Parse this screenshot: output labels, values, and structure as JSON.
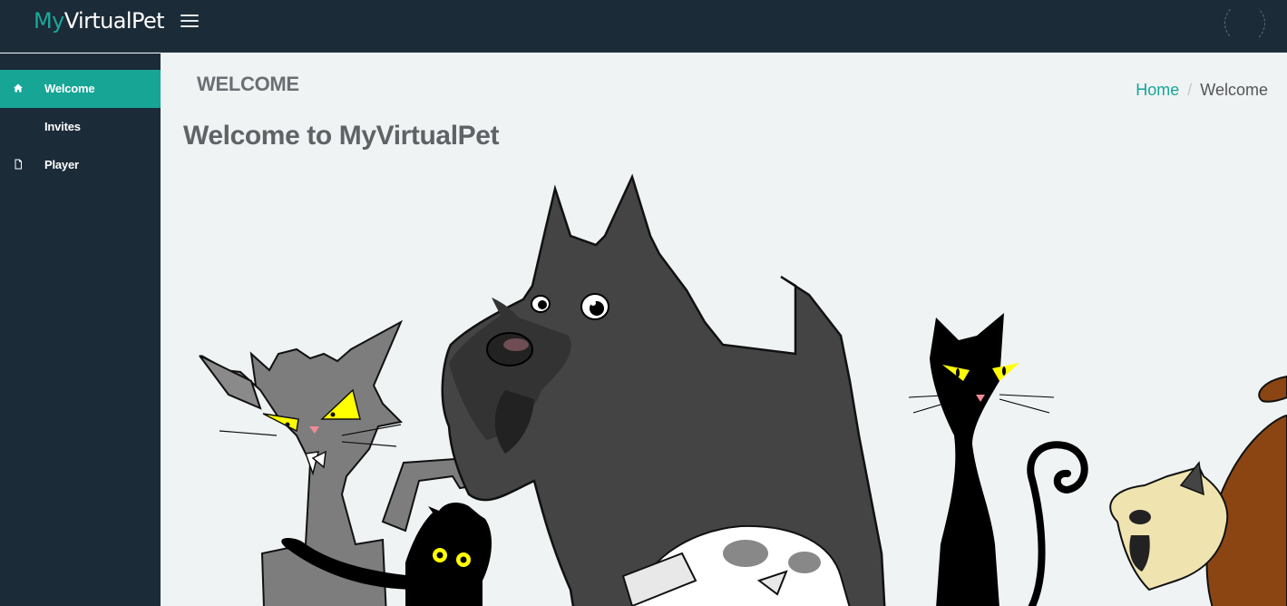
{
  "app": {
    "brand_part1": "My",
    "brand_part2": "VirtualPet"
  },
  "sidebar": {
    "items": [
      {
        "label": "Welcome",
        "icon": "home-icon",
        "active": true
      },
      {
        "label": "Invites",
        "icon": "",
        "active": false
      },
      {
        "label": "Player",
        "icon": "file-icon",
        "active": false
      }
    ]
  },
  "header": {
    "title": "WELCOME"
  },
  "breadcrumb": {
    "home": "Home",
    "separator": "/",
    "current": "Welcome"
  },
  "main": {
    "title": "Welcome to MyVirtualPet",
    "image": "pets-group-illustration"
  },
  "colors": {
    "accent": "#17a596",
    "navbar": "#1c2b38",
    "background": "#eff3f4"
  }
}
